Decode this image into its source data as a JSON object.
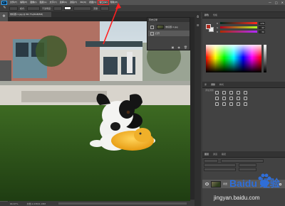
{
  "menubar": {
    "logo": "Ps",
    "items": [
      "文件(F)",
      "编辑(E)",
      "图像(I)",
      "图层(L)",
      "文字(Y)",
      "选择(S)",
      "滤镜(T)",
      "3D(D)",
      "视图(V)",
      "窗口(W)",
      "帮助(H)"
    ],
    "highlighted": "窗口(W)",
    "controls": [
      "—",
      "□",
      "✕"
    ]
  },
  "options": {
    "mode_label": "模式:",
    "opacity_label": "不透明度:",
    "flow_label": "流量:"
  },
  "document": {
    "tab_label": "未标题-1.jpg @ 66.7%(RGB/8#)",
    "status_zoom": "66.67%",
    "status_doc": "文档:1.03M/1.03M"
  },
  "history": {
    "title": "历史记录",
    "snapshot": "未标题-1.jpg",
    "state": "打开"
  },
  "right": {
    "color_tabs": [
      "颜色",
      "色板"
    ],
    "sliders": [
      {
        "label": "R",
        "value": "176"
      },
      {
        "label": "G",
        "value": "42"
      },
      {
        "label": "B",
        "value": "30"
      }
    ],
    "adjust_tabs": [
      "库",
      "调整",
      "样式"
    ],
    "adjust_title": "添加调整",
    "layers_tabs": [
      "图层",
      "通道",
      "路径"
    ],
    "layer_name": "背景"
  },
  "watermark": {
    "brand": "Baidu 经验",
    "url": "jingyan.baidu.com"
  }
}
